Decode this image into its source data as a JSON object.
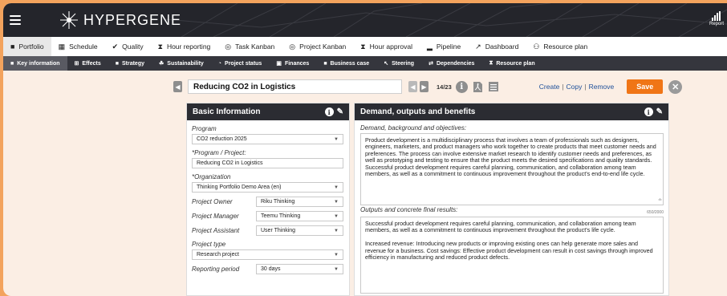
{
  "app": {
    "name": "HYPERGENE",
    "report_label": "Report"
  },
  "nav_primary": [
    {
      "label": "Portfolio",
      "icon": "briefcase-icon",
      "glyph": "■",
      "active": true
    },
    {
      "label": "Schedule",
      "icon": "calendar-icon",
      "glyph": "▦",
      "active": false
    },
    {
      "label": "Quality",
      "icon": "check-icon",
      "glyph": "✔",
      "active": false
    },
    {
      "label": "Hour reporting",
      "icon": "hourglass-icon",
      "glyph": "⧗",
      "active": false
    },
    {
      "label": "Task Kanban",
      "icon": "target-icon",
      "glyph": "◎",
      "active": false
    },
    {
      "label": "Project Kanban",
      "icon": "target-icon",
      "glyph": "◎",
      "active": false
    },
    {
      "label": "Hour approval",
      "icon": "hourglass-icon",
      "glyph": "⧗",
      "active": false
    },
    {
      "label": "Pipeline",
      "icon": "bar-chart-icon",
      "glyph": "▂",
      "active": false
    },
    {
      "label": "Dashboard",
      "icon": "line-chart-icon",
      "glyph": "↗",
      "active": false
    },
    {
      "label": "Resource plan",
      "icon": "users-icon",
      "glyph": "⚇",
      "active": false
    }
  ],
  "nav_secondary": [
    {
      "label": "Key information",
      "icon": "doc-icon",
      "glyph": "■",
      "active": true
    },
    {
      "label": "Effects",
      "icon": "grid-icon",
      "glyph": "⊞",
      "active": false
    },
    {
      "label": "Strategy",
      "icon": "flag-icon",
      "glyph": "■",
      "active": false
    },
    {
      "label": "Sustainability",
      "icon": "leaf-icon",
      "glyph": "☘",
      "active": false
    },
    {
      "label": "Project status",
      "icon": "dashboard-icon",
      "glyph": "◔",
      "active": false
    },
    {
      "label": "Finances",
      "icon": "money-icon",
      "glyph": "▣",
      "active": false
    },
    {
      "label": "Business case",
      "icon": "briefcase-icon",
      "glyph": "■",
      "active": false
    },
    {
      "label": "Steering",
      "icon": "steering-icon",
      "glyph": "↖",
      "active": false
    },
    {
      "label": "Dependencies",
      "icon": "arrows-icon",
      "glyph": "⇄",
      "active": false
    },
    {
      "label": "Resource plan",
      "icon": "hourglass-icon",
      "glyph": "⧗",
      "active": false
    }
  ],
  "project": {
    "title": "Reducing CO2 in Logistics",
    "counter": "14/23",
    "actions": {
      "create": "Create",
      "copy": "Copy",
      "remove": "Remove",
      "save": "Save"
    }
  },
  "basic_info": {
    "header": "Basic Information",
    "program_label": "Program",
    "program_value": "CO2 reduction 2025",
    "program_project_label": "*Program / Project:",
    "program_project_value": "Reducing CO2 in Logistics",
    "organization_label": "*Organization",
    "organization_value": "Thinking Portfolio Demo Area (en)",
    "owner_label": "Project Owner",
    "owner_value": "Riku Thinking",
    "manager_label": "Project Manager",
    "manager_value": "Teemu Thinking",
    "assistant_label": "Project Assistant",
    "assistant_value": "User Thinking",
    "type_label": "Project type",
    "type_value": "Research project",
    "period_label": "Reporting period",
    "period_value": "30 days"
  },
  "demand": {
    "header": "Demand, outputs and benefits",
    "background_label": "Demand, background and objectives:",
    "background_text": "Product development is a multidisciplinary process that involves a team of professionals such as designers, engineers, marketers, and product managers who work together to create products that meet customer needs and preferences. The process can involve extensive market research to identify customer needs and preferences, as well as prototyping and testing to ensure that the product meets the desired specifications and quality standards. Successful product development requires careful planning, communication, and collaboration among team members, as well as a commitment to continuous improvement throughout the product's end-to-end life cycle.",
    "char_count": "650/2000",
    "outputs_label": "Outputs and concrete final results:",
    "outputs_text": "Successful product development requires careful planning, communication, and collaboration among team members, as well as a commitment to continuous improvement throughout the product's life cycle.\n\nIncreased revenue: Introducing new products or improving existing ones can help generate more sales and revenue for a business. Cost savings: Effective product development can result in cost savings through improved efficiency in manufacturing and reduced product defects."
  },
  "colors": {
    "accent_orange": "#f07516",
    "dark_bar": "#24252b",
    "link_blue": "#1d4f9a"
  }
}
